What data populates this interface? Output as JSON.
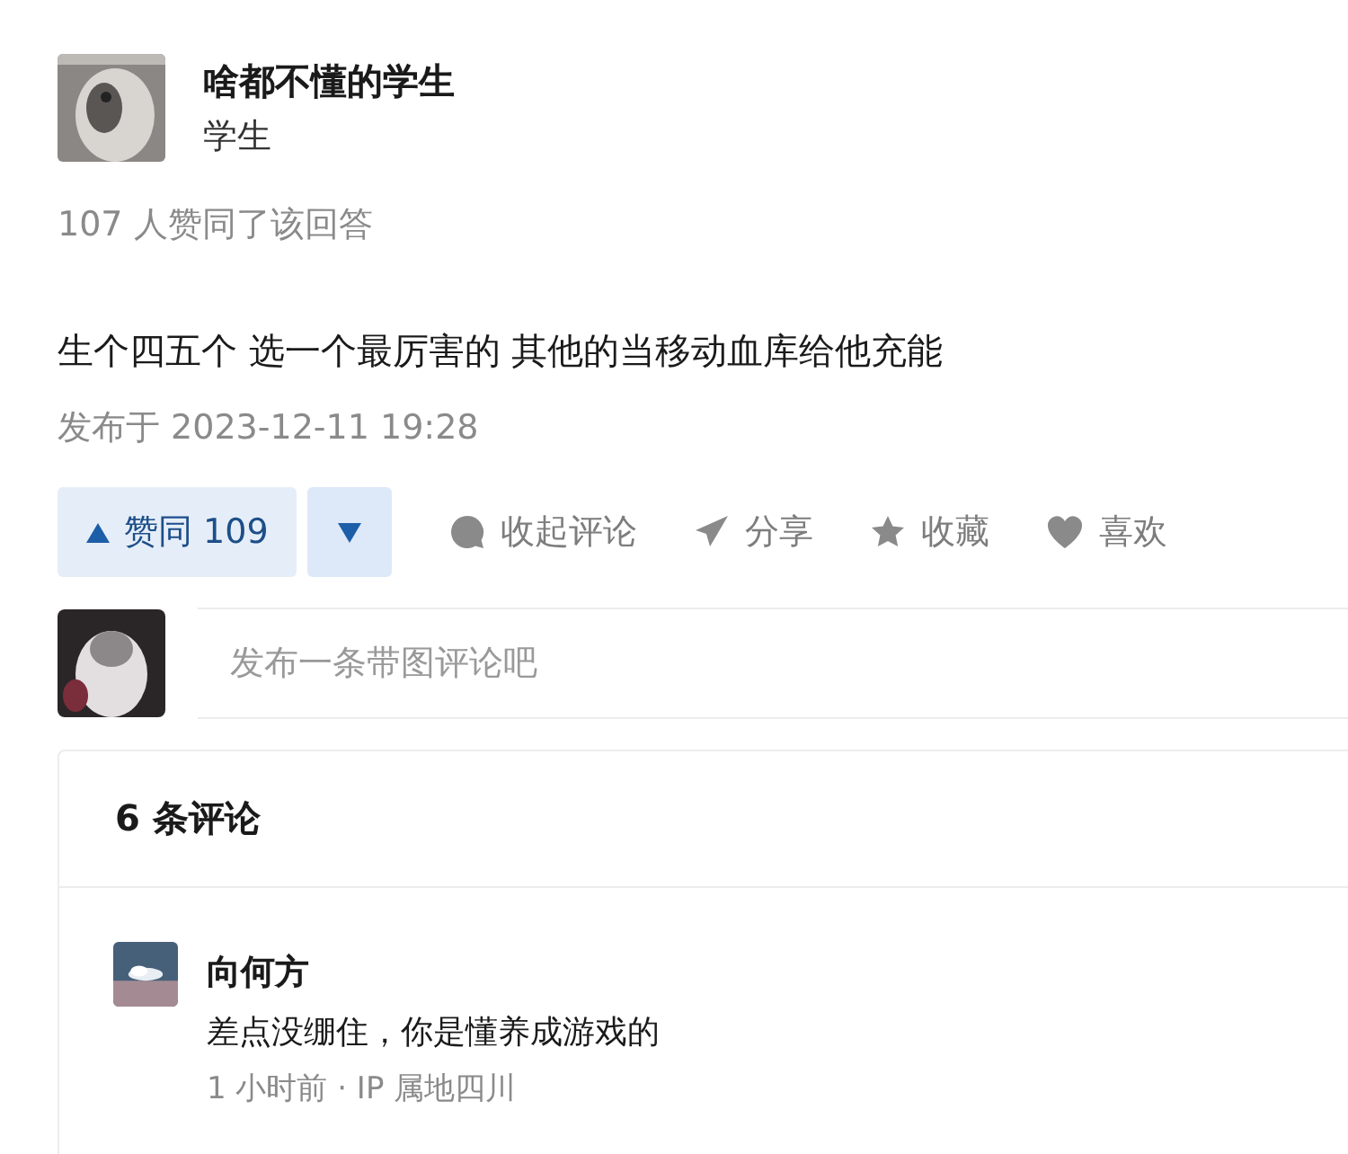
{
  "author": {
    "name": "啥都不懂的学生",
    "headline": "学生"
  },
  "upvote_summary": "107 人赞同了该回答",
  "content": "生个四五个 选一个最厉害的 其他的当移动血库给他充能",
  "published": "发布于 2023-12-11 19:28",
  "actions": {
    "upvote": {
      "label": "赞同 109"
    },
    "items": [
      {
        "kind": "comment",
        "label": "收起评论"
      },
      {
        "kind": "share",
        "label": "分享"
      },
      {
        "kind": "favorite",
        "label": "收藏"
      },
      {
        "kind": "like",
        "label": "喜欢"
      }
    ]
  },
  "comment_input": {
    "placeholder": "发布一条带图评论吧"
  },
  "comments": {
    "count": "6 条评论",
    "items": [
      {
        "author": "向何方",
        "text": "差点没绷住，你是懂养成游戏的",
        "meta": "1 小时前 · IP 属地四川"
      }
    ]
  }
}
